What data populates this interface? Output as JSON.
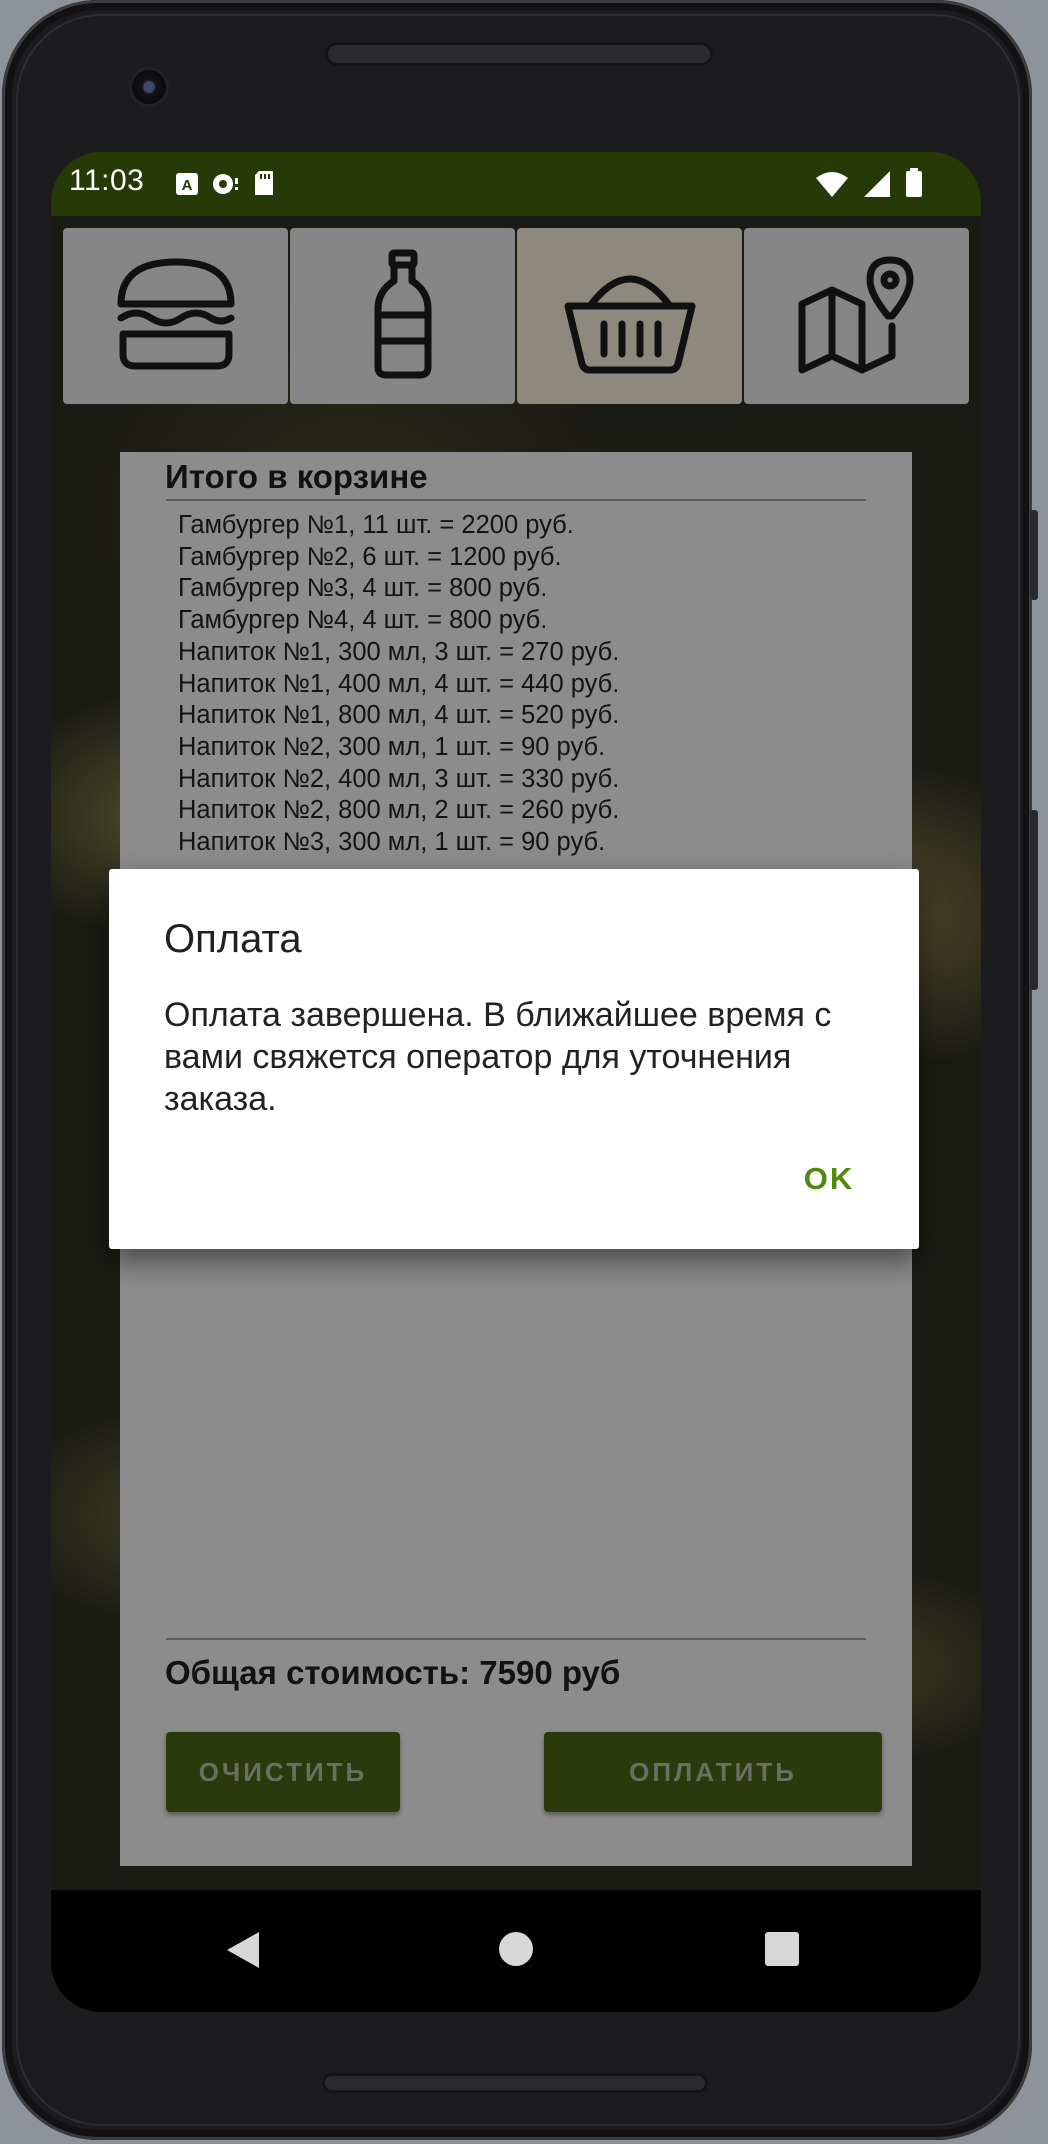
{
  "status_bar": {
    "time": "11:03",
    "left_icons": [
      "accessibility-icon",
      "sync-icon",
      "sd-card-icon"
    ],
    "right_icons": [
      "wifi-icon",
      "signal-icon",
      "battery-icon"
    ],
    "color": "#253a07"
  },
  "tabs": [
    {
      "icon": "burger-icon",
      "active": false
    },
    {
      "icon": "bottle-icon",
      "active": false
    },
    {
      "icon": "basket-icon",
      "active": true
    },
    {
      "icon": "map-pin-icon",
      "active": false
    }
  ],
  "cart": {
    "title": "Итого в корзине",
    "items": [
      "Гамбургер №1, 11 шт. = 2200 руб.",
      "Гамбургер №2, 6 шт. = 1200 руб.",
      "Гамбургер №3, 4 шт. = 800 руб.",
      "Гамбургер №4, 4 шт. = 800 руб.",
      "Напиток №1, 300 мл, 3 шт. = 270 руб.",
      "Напиток №1, 400 мл, 4 шт. = 440 руб.",
      "Напиток №1, 800 мл, 4 шт. = 520 руб.",
      "Напиток №2, 300 мл, 1 шт. = 90 руб.",
      "Напиток №2, 400 мл, 3 шт. = 330 руб.",
      "Напиток №2, 800 мл, 2 шт. = 260 руб.",
      "Напиток №3, 300 мл, 1 шт. = 90 руб."
    ],
    "total": "Общая стоимость: 7590 руб",
    "clear_label": "ОЧИСТИТЬ",
    "pay_label": "ОПЛАТИТЬ"
  },
  "dialog": {
    "title": "Оплата",
    "message": "Оплата завершена. В ближайшее время с вами свяжется оператор для уточнения заказа.",
    "ok_label": "OK",
    "accent": "#4f8a0c"
  },
  "nav_bar": {
    "icons": [
      "back-icon",
      "home-icon",
      "recents-icon"
    ]
  }
}
